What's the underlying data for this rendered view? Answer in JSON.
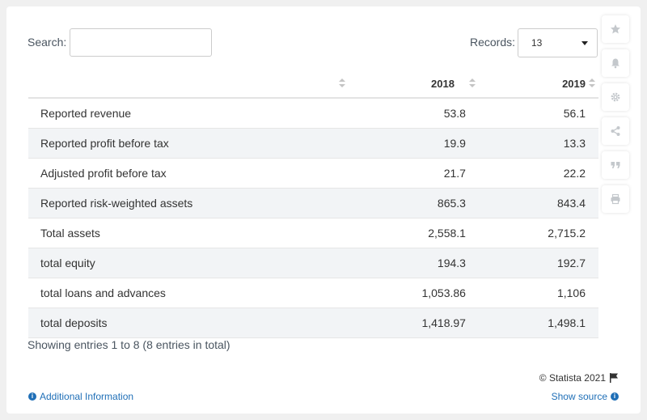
{
  "search": {
    "label": "Search:",
    "value": "",
    "placeholder": ""
  },
  "records": {
    "label": "Records:",
    "value": "13"
  },
  "table": {
    "headers": [
      "",
      "2018",
      "2019"
    ],
    "rows": [
      [
        "Reported revenue",
        "53.8",
        "56.1"
      ],
      [
        "Reported profit before tax",
        "19.9",
        "13.3"
      ],
      [
        "Adjusted profit before tax",
        "21.7",
        "22.2"
      ],
      [
        "Reported risk-weighted assets",
        "865.3",
        "843.4"
      ],
      [
        "Total assets",
        "2,558.1",
        "2,715.2"
      ],
      [
        "total equity",
        "194.3",
        "192.7"
      ],
      [
        "total loans and advances",
        "1,053.86",
        "1,106"
      ],
      [
        "total deposits",
        "1,418.97",
        "1,498.1"
      ]
    ]
  },
  "footer": {
    "entries_text": "Showing entries 1 to 8 (8 entries in total)",
    "copyright": "© Statista 2021",
    "additional_info": "Additional Information",
    "show_source": "Show source"
  },
  "side_tools": [
    "star-icon",
    "bell-icon",
    "gear-icon",
    "share-icon",
    "quote-icon",
    "print-icon"
  ],
  "colors": {
    "link": "#1f6fb7",
    "row_stripe": "#f2f4f6",
    "background": "#f0f0f0"
  }
}
